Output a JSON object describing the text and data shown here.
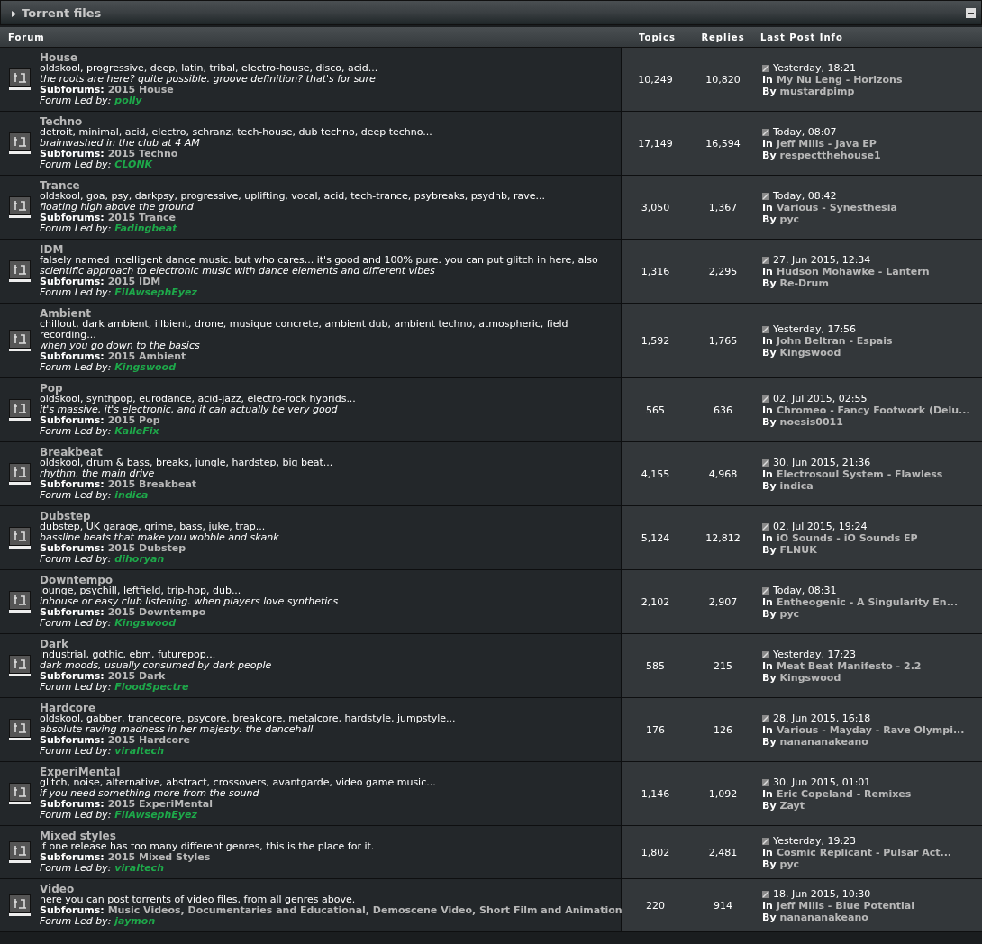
{
  "category": {
    "title": "Torrent files",
    "expanded": true
  },
  "columns": [
    "Forum",
    "Topics",
    "Replies",
    "Last Post Info"
  ],
  "forums": [
    {
      "name": "House",
      "description": "oldskool, progressive, deep, latin, tribal, electro-house, disco, acid...",
      "tagline": "the roots are here? quite possible. groove definition? that's for sure",
      "subforums_label": "Subforums:",
      "subforums": "2015 House",
      "led_label": "Forum Led by:",
      "leader": "polly",
      "topics": "10,249",
      "replies": "10,820",
      "last_date": "Yesterday, 18:21",
      "in_label": "In",
      "last_thread": "My Nu Leng - Horizons",
      "by_label": "By",
      "last_user": "mustardpimp"
    },
    {
      "name": "Techno",
      "description": "detroit, minimal, acid, electro, schranz, tech-house, dub techno, deep techno...",
      "tagline": "brainwashed in the club at 4 AM",
      "subforums_label": "Subforums:",
      "subforums": "2015 Techno",
      "led_label": "Forum Led by:",
      "leader": "CLONK",
      "topics": "17,149",
      "replies": "16,594",
      "last_date": "Today, 08:07",
      "in_label": "In",
      "last_thread": "Jeff Mills - Java EP",
      "by_label": "By",
      "last_user": "respectthehouse1"
    },
    {
      "name": "Trance",
      "description": "oldskool, goa, psy, darkpsy, progressive, uplifting, vocal, acid, tech-trance, psybreaks, psydnb, rave...",
      "tagline": "floating high above the ground",
      "subforums_label": "Subforums:",
      "subforums": "2015 Trance",
      "led_label": "Forum Led by:",
      "leader": "Fadingbeat",
      "topics": "3,050",
      "replies": "1,367",
      "last_date": "Today, 08:42",
      "in_label": "In",
      "last_thread": "Various - Synesthesia",
      "by_label": "By",
      "last_user": "pyc"
    },
    {
      "name": "IDM",
      "description": "falsely named intelligent dance music. but who cares... it's good and 100% pure. you can put glitch in here, also",
      "tagline": "scientific approach to electronic music with dance elements and different vibes",
      "subforums_label": "Subforums:",
      "subforums": "2015 IDM",
      "led_label": "Forum Led by:",
      "leader": "FilAwsephEyez",
      "topics": "1,316",
      "replies": "2,295",
      "last_date": "27. Jun 2015, 12:34",
      "in_label": "In",
      "last_thread": "Hudson Mohawke - Lantern",
      "by_label": "By",
      "last_user": "Re-Drum"
    },
    {
      "name": "Ambient",
      "description": "chillout, dark ambient, illbient, drone, musique concrete, ambient dub, ambient techno, atmospheric, field recording...",
      "tagline": "when you go down to the basics",
      "subforums_label": "Subforums:",
      "subforums": "2015 Ambient",
      "led_label": "Forum Led by:",
      "leader": "Kingswood",
      "topics": "1,592",
      "replies": "1,765",
      "last_date": "Yesterday, 17:56",
      "in_label": "In",
      "last_thread": "John Beltran - Espais",
      "by_label": "By",
      "last_user": "Kingswood"
    },
    {
      "name": "Pop",
      "description": "oldskool, synthpop, eurodance, acid-jazz, electro-rock hybrids...",
      "tagline": "it's massive, it's electronic, and it can actually be very good",
      "subforums_label": "Subforums:",
      "subforums": "2015 Pop",
      "led_label": "Forum Led by:",
      "leader": "KalleFix",
      "topics": "565",
      "replies": "636",
      "last_date": "02. Jul 2015, 02:55",
      "in_label": "In",
      "last_thread": "Chromeo - Fancy Footwork (Delu...",
      "by_label": "By",
      "last_user": "noesis0011"
    },
    {
      "name": "Breakbeat",
      "description": "oldskool, drum & bass, breaks, jungle, hardstep, big beat...",
      "tagline": "rhythm, the main drive",
      "subforums_label": "Subforums:",
      "subforums": "2015 Breakbeat",
      "led_label": "Forum Led by:",
      "leader": "indica",
      "topics": "4,155",
      "replies": "4,968",
      "last_date": "30. Jun 2015, 21:36",
      "in_label": "In",
      "last_thread": "Electrosoul System - Flawless",
      "by_label": "By",
      "last_user": "indica"
    },
    {
      "name": "Dubstep",
      "description": "dubstep, UK garage, grime, bass, juke, trap...",
      "tagline": "bassline beats that make you wobble and skank",
      "subforums_label": "Subforums:",
      "subforums": "2015 Dubstep",
      "led_label": "Forum Led by:",
      "leader": "dihoryan",
      "topics": "5,124",
      "replies": "12,812",
      "last_date": "02. Jul 2015, 19:24",
      "in_label": "In",
      "last_thread": "iO Sounds - iO Sounds EP",
      "by_label": "By",
      "last_user": "FLNUK"
    },
    {
      "name": "Downtempo",
      "description": "lounge, psychill, leftfield, trip-hop, dub...",
      "tagline": "inhouse or easy club listening. when players love synthetics",
      "subforums_label": "Subforums:",
      "subforums": "2015 Downtempo",
      "led_label": "Forum Led by:",
      "leader": "Kingswood",
      "topics": "2,102",
      "replies": "2,907",
      "last_date": "Today, 08:31",
      "in_label": "In",
      "last_thread": "Entheogenic - A Singularity En...",
      "by_label": "By",
      "last_user": "pyc"
    },
    {
      "name": "Dark",
      "description": "industrial, gothic, ebm, futurepop...",
      "tagline": "dark moods, usually consumed by dark people",
      "subforums_label": "Subforums:",
      "subforums": "2015 Dark",
      "led_label": "Forum Led by:",
      "leader": "FloodSpectre",
      "topics": "585",
      "replies": "215",
      "last_date": "Yesterday, 17:23",
      "in_label": "In",
      "last_thread": "Meat Beat Manifesto - 2.2",
      "by_label": "By",
      "last_user": "Kingswood"
    },
    {
      "name": "Hardcore",
      "description": "oldskool, gabber, trancecore, psycore, breakcore, metalcore, hardstyle, jumpstyle...",
      "tagline": "absolute raving madness in her majesty: the dancehall",
      "subforums_label": "Subforums:",
      "subforums": "2015 Hardcore",
      "led_label": "Forum Led by:",
      "leader": "viraltech",
      "topics": "176",
      "replies": "126",
      "last_date": "28. Jun 2015, 16:18",
      "in_label": "In",
      "last_thread": "Various - Mayday - Rave Olympi...",
      "by_label": "By",
      "last_user": "nanananakeano"
    },
    {
      "name": "ExperiMental",
      "description": "glitch, noise, alternative, abstract, crossovers, avantgarde, video game music...",
      "tagline": "if you need something more from the sound",
      "subforums_label": "Subforums:",
      "subforums": "2015 ExperiMental",
      "led_label": "Forum Led by:",
      "leader": "FilAwsephEyez",
      "topics": "1,146",
      "replies": "1,092",
      "last_date": "30. Jun 2015, 01:01",
      "in_label": "In",
      "last_thread": "Eric Copeland - Remixes",
      "by_label": "By",
      "last_user": "Zayt"
    },
    {
      "name": "Mixed styles",
      "description": "if one release has too many different genres, this is the place for it.",
      "subforums_label": "Subforums:",
      "subforums": "2015 Mixed Styles",
      "led_label": "Forum Led by:",
      "leader": "viraltech",
      "topics": "1,802",
      "replies": "2,481",
      "last_date": "Yesterday, 19:23",
      "in_label": "In",
      "last_thread": "Cosmic Replicant - Pulsar Act...",
      "by_label": "By",
      "last_user": "pyc"
    },
    {
      "name": "Video",
      "description": "here you can post torrents of video files, from all genres above.",
      "subforums_label": "Subforums:",
      "subforums": "Music Videos, Documentaries and Educational, Demoscene Video, Short Film and Animation",
      "led_label": "Forum Led by:",
      "leader": "jaymon",
      "topics": "220",
      "replies": "914",
      "last_date": "18. Jun 2015, 10:30",
      "in_label": "In",
      "last_thread": "Jeff Mills - Blue Potential",
      "by_label": "By",
      "last_user": "nanananakeano"
    }
  ]
}
